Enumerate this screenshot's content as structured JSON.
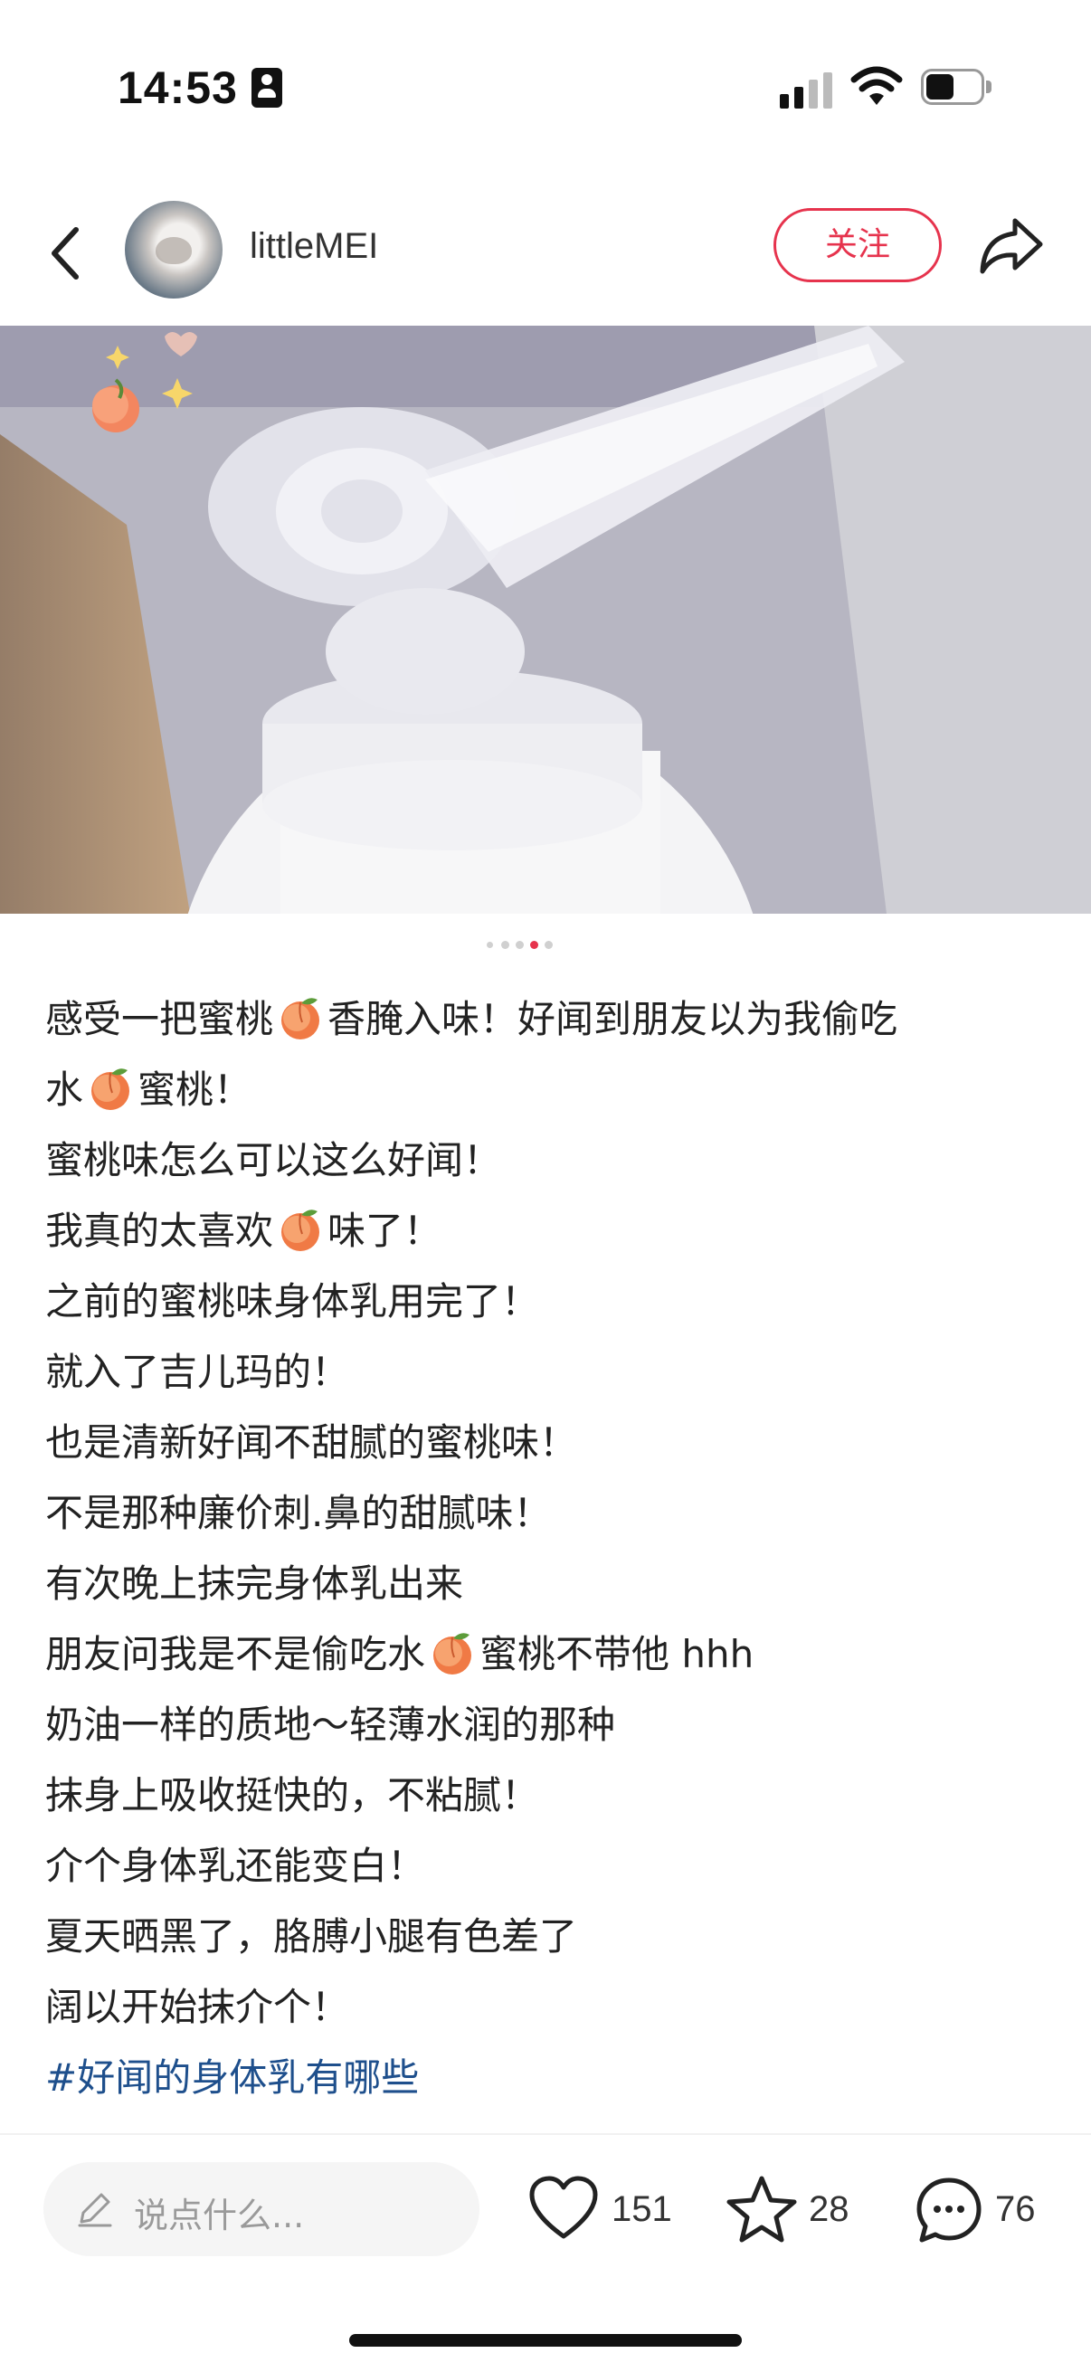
{
  "status_bar": {
    "time": "14:53",
    "icons": [
      "id-card-icon",
      "signal-icon",
      "wifi-icon",
      "battery-icon"
    ]
  },
  "header": {
    "back_icon": "back-chevron-icon",
    "username": "littleMEI",
    "follow_label": "关注",
    "share_icon": "share-icon"
  },
  "carousel": {
    "total": 5,
    "active_index": 3,
    "active_color": "#e6334d"
  },
  "post": {
    "lines": [
      [
        "感受一把蜜桃",
        "peach",
        "香腌入味！好闻到朋友以为我偷吃"
      ],
      [
        "水",
        "peach",
        "蜜桃！"
      ],
      [
        "蜜桃味怎么可以这么好闻！"
      ],
      [
        "我真的太喜欢",
        "peach",
        "味了！"
      ],
      [
        "之前的蜜桃味身体乳用完了！"
      ],
      [
        "就入了吉儿玛的！"
      ],
      [
        "也是清新好闻不甜腻的蜜桃味！"
      ],
      [
        "不是那种廉价刺.鼻的甜腻味！"
      ],
      [
        "有次晚上抹完身体乳出来"
      ],
      [
        "朋友问我是不是偷吃水",
        "peach",
        "蜜桃不带他 hhh"
      ],
      [
        "奶油一样的质地～轻薄水润的那种"
      ],
      [
        "抹身上吸收挺快的，不粘腻！"
      ],
      [
        "介个身体乳还能变白！"
      ],
      [
        "夏天晒黑了，胳膊小腿有色差了"
      ],
      [
        "阔以开始抹介个！"
      ]
    ],
    "hashtag": "#好闻的身体乳有哪些"
  },
  "bottom_bar": {
    "comment_placeholder": "说点什么...",
    "likes": "151",
    "favorites": "28",
    "comments": "76"
  },
  "colors": {
    "accent": "#e6334d",
    "hashtag": "#1e4f8c"
  }
}
